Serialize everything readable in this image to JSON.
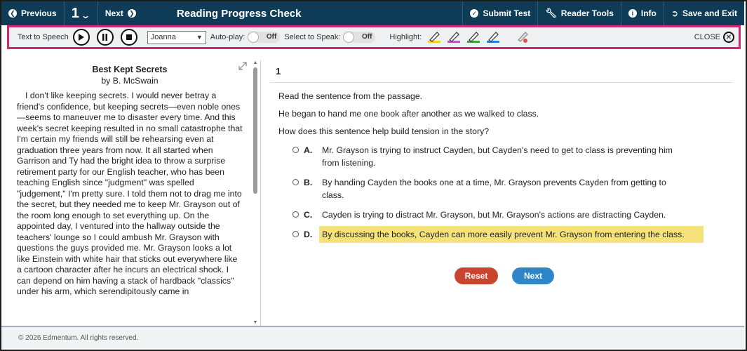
{
  "colors": {
    "topbar": "#0e3c56",
    "toolbar_border": "#d12770",
    "highlight": "#f5e27a",
    "reset": "#c9452f",
    "next": "#2e86c9"
  },
  "topbar": {
    "previous": "Previous",
    "question_number": "1",
    "next": "Next",
    "title": "Reading Progress Check",
    "submit_test": "Submit Test",
    "reader_tools": "Reader Tools",
    "info": "Info",
    "save_exit": "Save and Exit"
  },
  "toolbar": {
    "tts_label": "Text to Speech",
    "voice": "Joanna",
    "autoplay_label": "Auto-play:",
    "autoplay_state": "Off",
    "select_to_speak_label": "Select to Speak:",
    "select_to_speak_state": "Off",
    "highlight_label": "Highlight:",
    "highlighter_colors": [
      "#f2d21b",
      "#c45ab3",
      "#3aa641",
      "#2f7fd4"
    ],
    "close_label": "CLOSE"
  },
  "passage": {
    "title": "Best Kept Secrets",
    "author": "by B. McSwain",
    "body": "I don't like keeping secrets. I would never betray a friend's confidence, but keeping secrets—even noble ones—seems to maneuver me to disaster every time. And this week's secret keeping resulted in no small catastrophe that I'm certain my friends will still be rehearsing even at graduation three years from now. It all started when Garrison and Ty had the bright idea to throw a surprise retirement party for our English teacher, who has been teaching English since \"judgment\" was spelled \"judgement,\" I'm pretty sure. I told them not to drag me into the secret, but they needed me to keep Mr. Grayson out of the room long enough to set everything up. On the appointed day, I ventured into the hallway outside the teachers' lounge so I could ambush Mr. Grayson with questions the guys provided me. Mr. Grayson looks a lot like Einstein with white hair that sticks out everywhere like a cartoon character after he incurs an electrical shock. I can depend on him having a stack of hardback \"classics\" under his arm, which serendipitously came in"
  },
  "question": {
    "number": "1",
    "prompt_1": "Read the sentence from the passage.",
    "prompt_2": "He began to hand me one book after another as we walked to class.",
    "prompt_3": "How does this sentence help build tension in the story?",
    "choices": [
      {
        "letter": "A.",
        "text": "Mr. Grayson is trying to instruct Cayden, but Cayden's need to get to class is preventing him from listening."
      },
      {
        "letter": "B.",
        "text": "By handing Cayden the books one at a time, Mr. Grayson prevents Cayden from getting to class."
      },
      {
        "letter": "C.",
        "text": "Cayden is trying to distract Mr. Grayson, but Mr. Grayson's actions are distracting Cayden."
      },
      {
        "letter": "D.",
        "text": "By discussing the books, Cayden can more easily prevent Mr. Grayson from entering the class."
      }
    ],
    "reset_label": "Reset",
    "next_label": "Next"
  },
  "footer": {
    "copyright": "© 2026 Edmentum. All rights reserved."
  }
}
